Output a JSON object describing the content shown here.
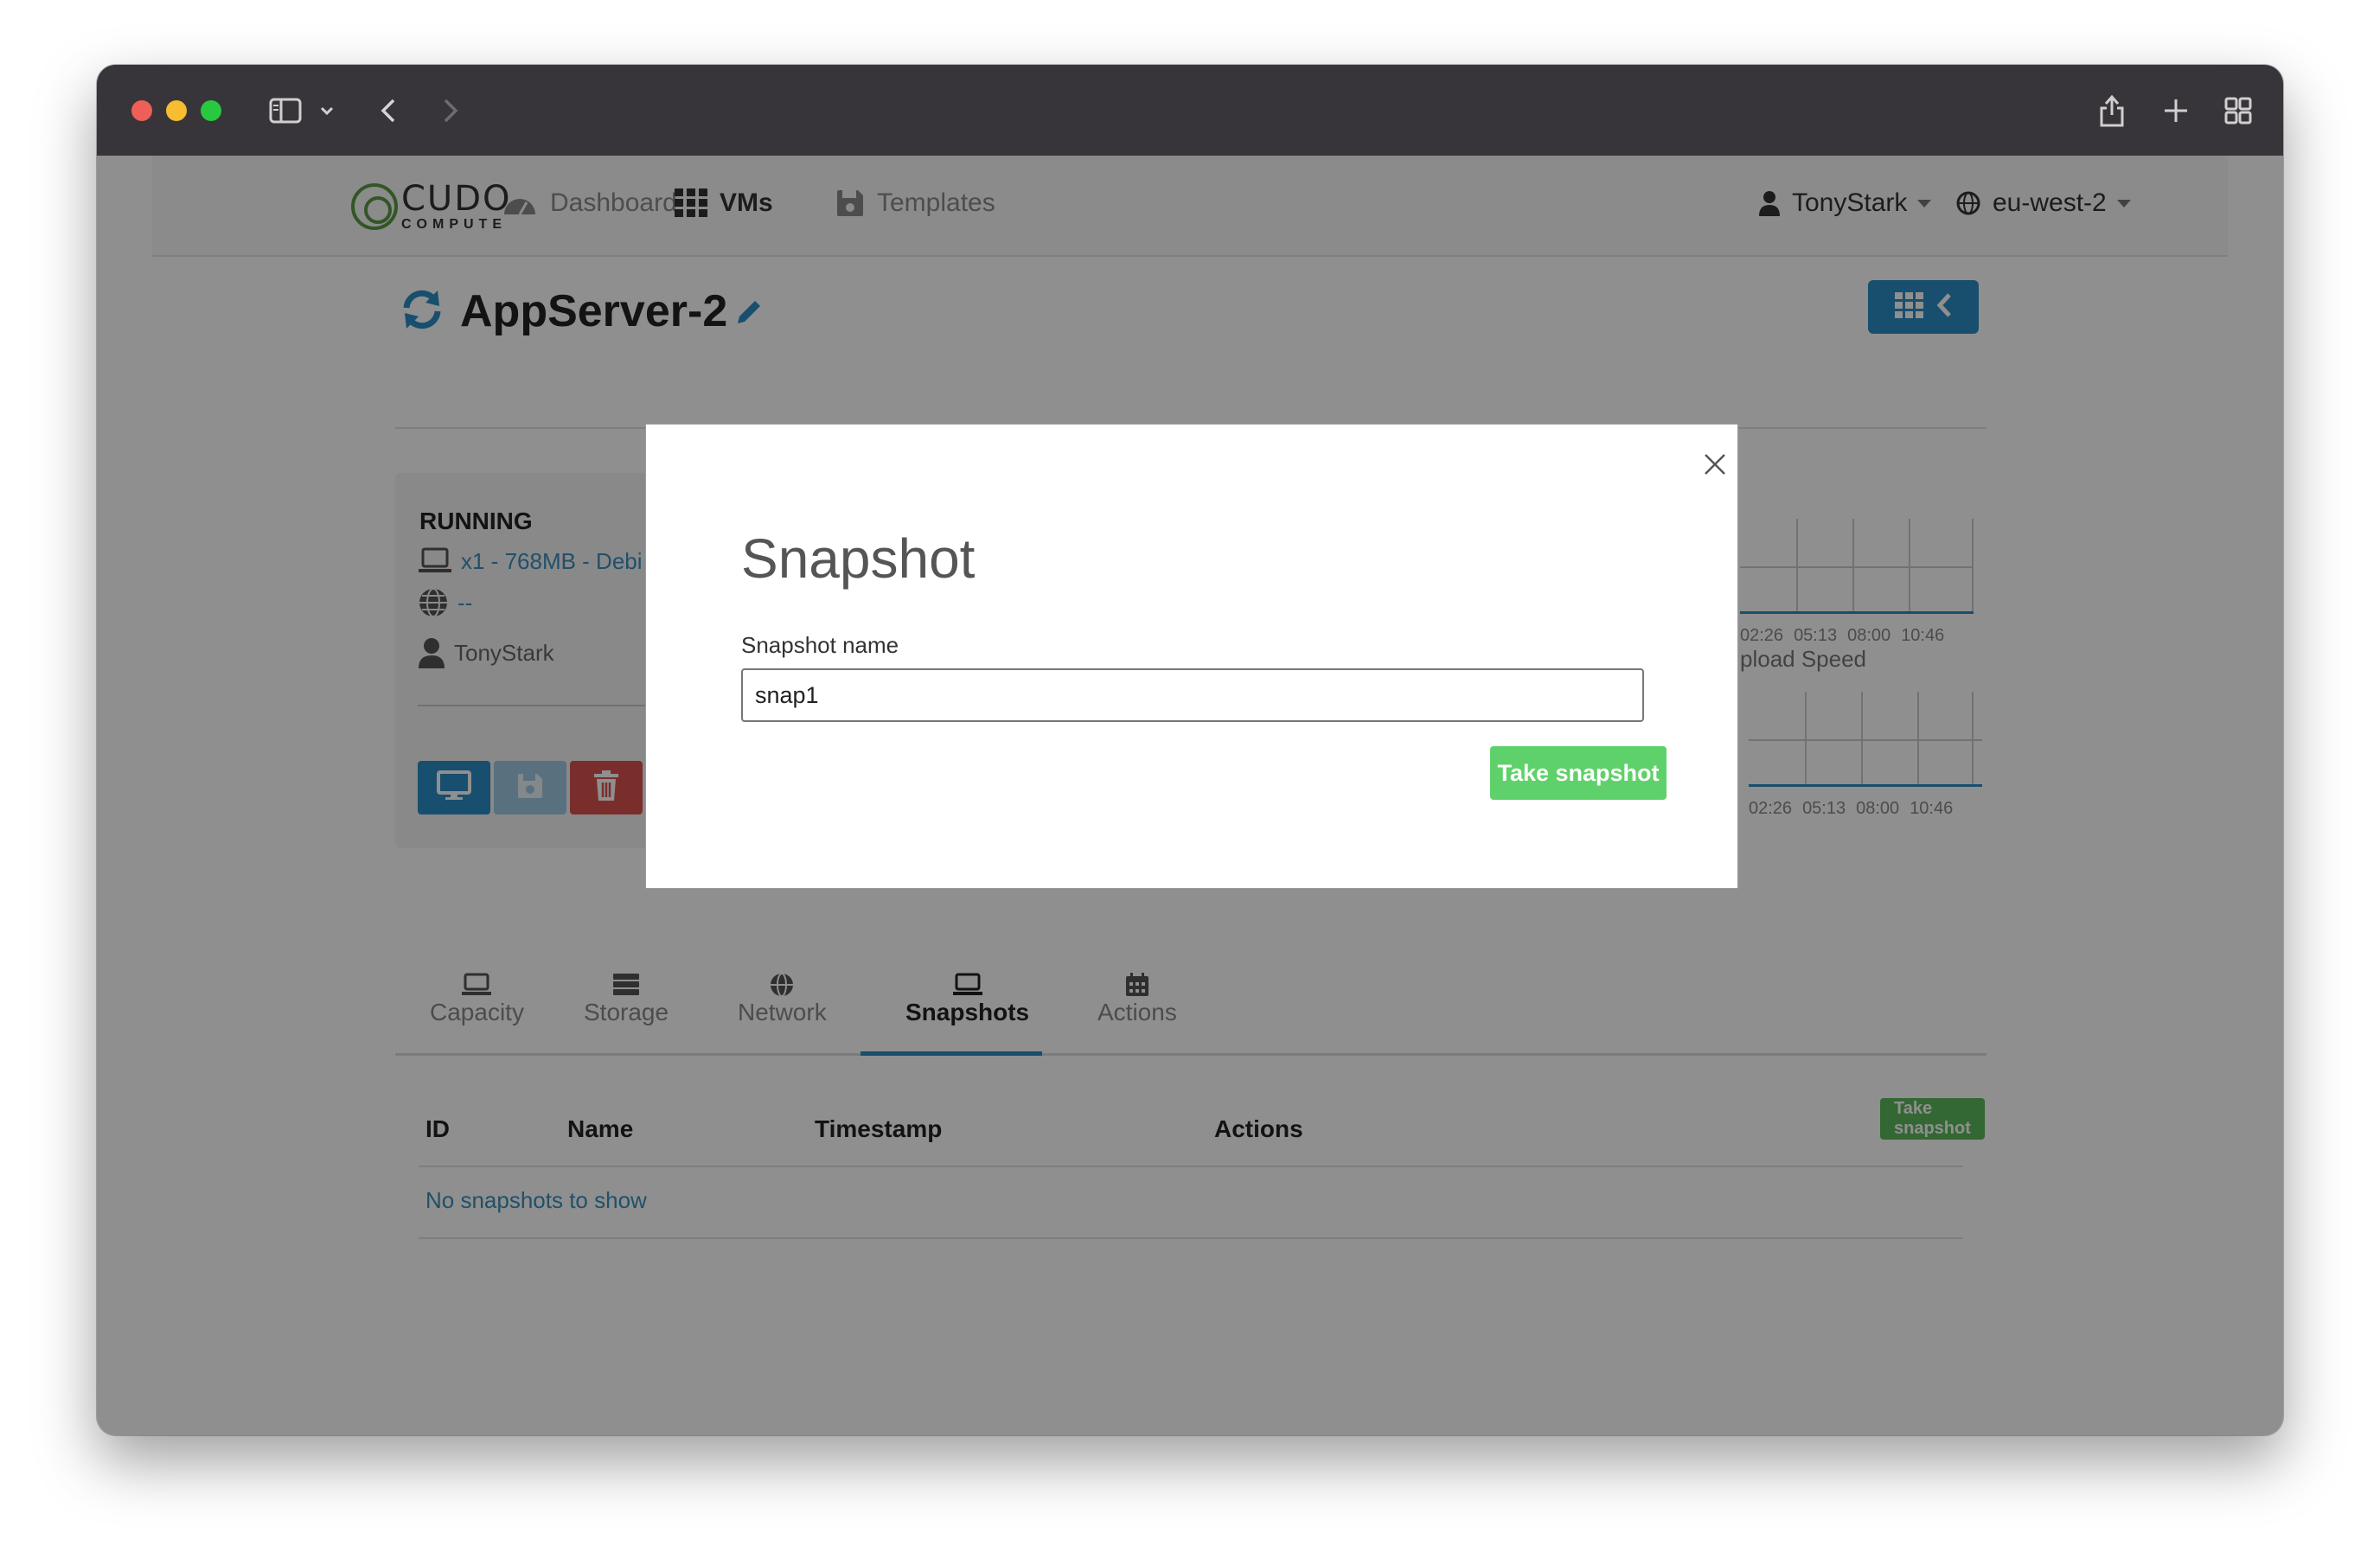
{
  "browser": {
    "icons": [
      "sidebar-icon",
      "chevron-down-icon",
      "back-icon",
      "forward-icon",
      "share-icon",
      "new-tab-icon",
      "tab-overview-icon"
    ]
  },
  "nav": {
    "logo_main": "CUDO",
    "logo_sub": "COMPUTE",
    "items": [
      {
        "label": "Dashboard",
        "icon": "dashboard-icon"
      },
      {
        "label": "VMs",
        "icon": "grid-icon"
      },
      {
        "label": "Templates",
        "icon": "save-icon"
      }
    ],
    "user": "TonyStark",
    "region": "eu-west-2"
  },
  "vm": {
    "name": "AppServer-2",
    "status": "RUNNING",
    "spec": "x1 - 768MB - Debi",
    "ip": "--",
    "owner": "TonyStark"
  },
  "charts": {
    "upload_label": "pload Speed",
    "ticks": [
      "02:26",
      "05:13",
      "08:00",
      "10:46"
    ]
  },
  "tabs": [
    {
      "label": "Capacity",
      "icon": "laptop-icon"
    },
    {
      "label": "Storage",
      "icon": "storage-icon"
    },
    {
      "label": "Network",
      "icon": "globe-icon"
    },
    {
      "label": "Snapshots",
      "icon": "laptop-icon"
    },
    {
      "label": "Actions",
      "icon": "calendar-icon"
    }
  ],
  "active_tab": "Snapshots",
  "table": {
    "headers": [
      "ID",
      "Name",
      "Timestamp",
      "Actions"
    ],
    "take_button": "Take snapshot",
    "empty_message": "No snapshots to show"
  },
  "modal": {
    "title": "Snapshot",
    "field_label": "Snapshot name",
    "field_value": "snap1",
    "submit_label": "Take snapshot"
  },
  "colors": {
    "accent": "#2b8cc4",
    "success": "#5cb85c",
    "danger": "#d9534f",
    "titlebar": "#38353a"
  }
}
